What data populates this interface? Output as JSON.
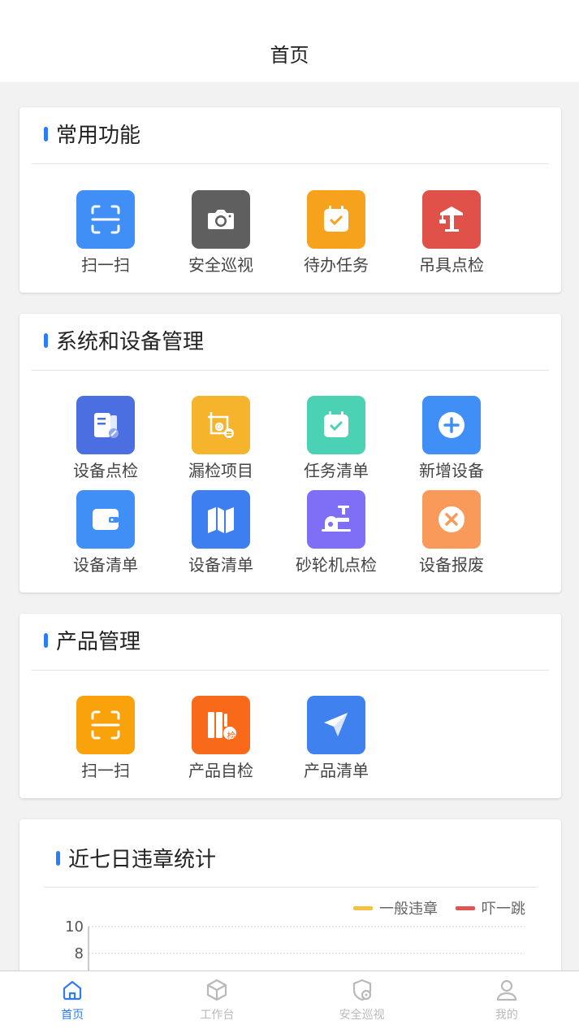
{
  "header": {
    "title": "首页"
  },
  "sections": {
    "common": {
      "title": "常用功能",
      "items": [
        {
          "label": "扫一扫",
          "color": "#3f8ff6",
          "icon": "scan-icon"
        },
        {
          "label": "安全巡视",
          "color": "#5f5f5f",
          "icon": "camera-icon"
        },
        {
          "label": "待办任务",
          "color": "#f7a21c",
          "icon": "calendar-check-icon"
        },
        {
          "label": "吊具点检",
          "color": "#e05149",
          "icon": "crane-icon"
        }
      ]
    },
    "device": {
      "title": "系统和设备管理",
      "items": [
        {
          "label": "设备点检",
          "color": "#4b6fe0",
          "icon": "device-check-icon"
        },
        {
          "label": "漏检项目",
          "color": "#f5b42b",
          "icon": "missed-check-icon"
        },
        {
          "label": "任务清单",
          "color": "#4bd2b4",
          "icon": "calendar-check-icon"
        },
        {
          "label": "新增设备",
          "color": "#3f8ff6",
          "icon": "plus-circle-icon"
        },
        {
          "label": "设备清单",
          "color": "#3f8ff6",
          "icon": "wallet-icon"
        },
        {
          "label": "设备清单",
          "color": "#3d7ff0",
          "icon": "map-icon"
        },
        {
          "label": "砂轮机点检",
          "color": "#7e6ff6",
          "icon": "grinder-icon"
        },
        {
          "label": "设备报废",
          "color": "#f99a5a",
          "icon": "close-circle-icon"
        }
      ]
    },
    "product": {
      "title": "产品管理",
      "items": [
        {
          "label": "扫一扫",
          "color": "#f9a20b",
          "icon": "scan-icon"
        },
        {
          "label": "产品自检",
          "color": "#f8691a",
          "icon": "binders-icon",
          "badge": "检"
        },
        {
          "label": "产品清单",
          "color": "#3f82ef",
          "icon": "paper-plane-icon"
        }
      ]
    },
    "stats": {
      "title": "近七日违章统计",
      "legend": [
        {
          "label": "一般违章",
          "color": "#f5c342"
        },
        {
          "label": "吓一跳",
          "color": "#e05452"
        }
      ]
    }
  },
  "chart_data": {
    "type": "line",
    "title": "近七日违章统计",
    "legend": [
      "一般违章",
      "吓一跳"
    ],
    "y_ticks": [
      "10",
      "8"
    ],
    "ylim": [
      0,
      10
    ],
    "grid": true,
    "legend_position": "top-right",
    "series": [
      {
        "name": "一般违章",
        "values": []
      },
      {
        "name": "吓一跳",
        "values": []
      }
    ]
  },
  "tabbar": [
    {
      "label": "首页",
      "icon": "home-icon",
      "active": true
    },
    {
      "label": "工作台",
      "icon": "cube-icon",
      "active": false
    },
    {
      "label": "安全巡视",
      "icon": "shield-eye-icon",
      "active": false
    },
    {
      "label": "我的",
      "icon": "user-icon",
      "active": false
    }
  ]
}
